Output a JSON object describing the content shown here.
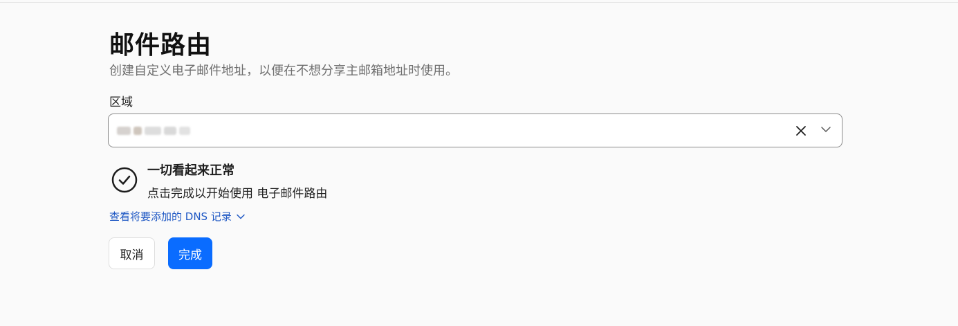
{
  "header": {
    "title": "邮件路由",
    "subtitle": "创建自定义电子邮件地址，以便在不想分享主邮箱地址时使用。"
  },
  "region": {
    "label": "区域",
    "value": "",
    "clear_icon": "close-icon",
    "expand_icon": "chevron-down-icon"
  },
  "status": {
    "icon": "check-circle-icon",
    "title": "一切看起来正常",
    "description": "点击完成以开始使用 电子邮件路由"
  },
  "dns": {
    "link_label": "查看将要添加的 DNS 记录",
    "icon": "chevron-down-icon"
  },
  "actions": {
    "cancel_label": "取消",
    "done_label": "完成"
  },
  "colors": {
    "background": "#fafafa",
    "primary": "#0a6cff",
    "link": "#1f58c4",
    "subtitle": "#6e6e6e",
    "border": "#8a8a8a"
  }
}
